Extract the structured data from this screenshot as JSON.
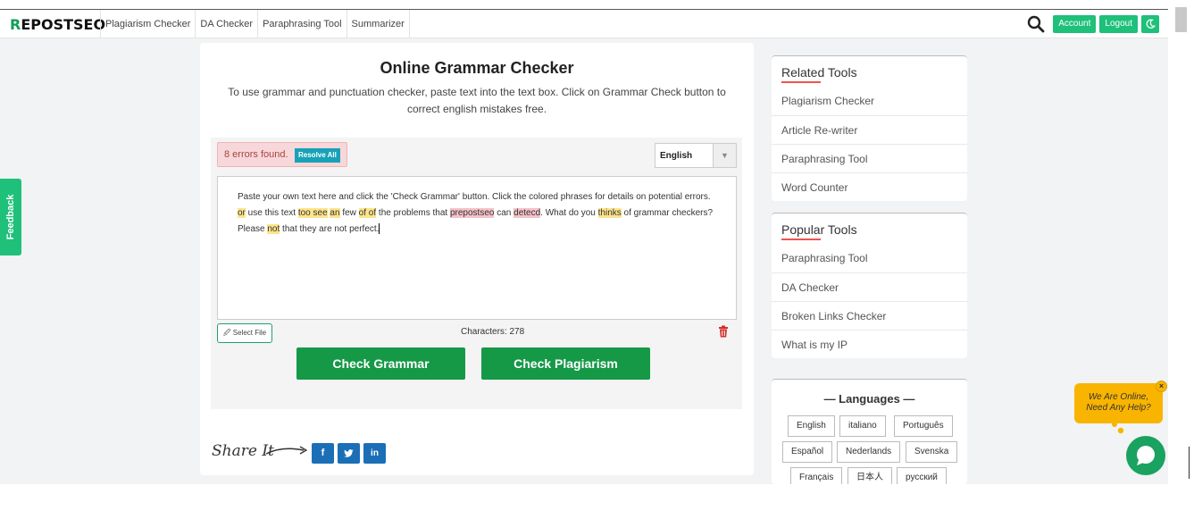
{
  "nav": {
    "logo_prefix": "R",
    "logo_text": "EPOSTS",
    "logo_suffix": "EO",
    "links": [
      "Plagiarism Checker",
      "DA Checker",
      "Paraphrasing Tool",
      "Summarizer"
    ],
    "account_label": "Account",
    "logout_label": "Logout"
  },
  "feedback": {
    "label": "Feedback"
  },
  "main": {
    "title": "Online Grammar Checker",
    "subtitle": "To use grammar and punctuation checker, paste text into the text box. Click on Grammar Check button to correct english mistakes free.",
    "errors_text": "8 errors found.",
    "resolve_label": "Resolve All",
    "language_value": "English",
    "text_segments": [
      {
        "t": "Paste your own text here and click the 'Check Grammar' button. Click the colored phrases for details on potential errors. "
      },
      {
        "t": "or",
        "hl": "y"
      },
      {
        "t": " use this text "
      },
      {
        "t": "too see",
        "hl": "y"
      },
      {
        "t": " "
      },
      {
        "t": "an",
        "hl": "y"
      },
      {
        "t": " few "
      },
      {
        "t": "of of",
        "hl": "y"
      },
      {
        "t": " the problems that "
      },
      {
        "t": "prepostseo",
        "hl": "p"
      },
      {
        "t": " can "
      },
      {
        "t": "detecd",
        "hl": "p"
      },
      {
        "t": ". What do you "
      },
      {
        "t": "thinks",
        "hl": "y"
      },
      {
        "t": " of grammar checkers? Please "
      },
      {
        "t": "not",
        "hl": "y"
      },
      {
        "t": " that they are not perfect."
      }
    ],
    "select_file_label": "Select File",
    "characters_text": "Characters: 278",
    "check_grammar_label": "Check Grammar",
    "check_plagiarism_label": "Check Plagiarism",
    "share_label": "Share It"
  },
  "related_tools": {
    "title": "Related Tools",
    "items": [
      "Plagiarism Checker",
      "Article Re-writer",
      "Paraphrasing Tool",
      "Word Counter"
    ]
  },
  "popular_tools": {
    "title": "Popular Tools",
    "items": [
      "Paraphrasing Tool",
      "DA Checker",
      "Broken Links Checker",
      "What is my IP"
    ]
  },
  "languages": {
    "title": "— Languages —",
    "items": [
      "English",
      "italiano",
      "Português",
      "Español",
      "Nederlands",
      "Svenska",
      "Français",
      "日本人",
      "русский"
    ]
  },
  "chat": {
    "bubble_line1": "We Are Online,",
    "bubble_line2": "Need Any Help?"
  },
  "colors": {
    "brand_green": "#1ec07a",
    "button_green": "#159947",
    "highlight_yellow": "#fde48b",
    "highlight_pink": "#f4c2c9",
    "social_blue": "#1b6fb6"
  }
}
